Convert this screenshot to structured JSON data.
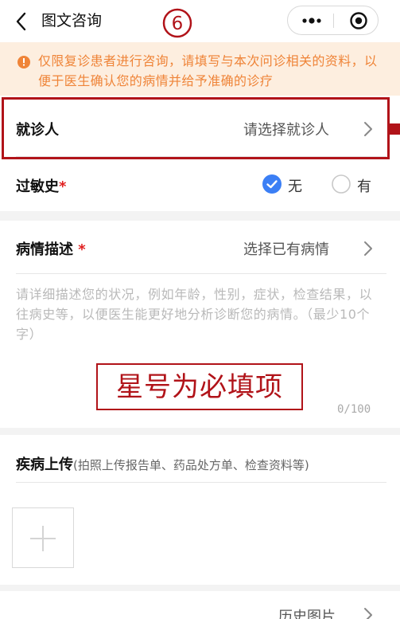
{
  "header": {
    "title": "图文咨询",
    "step_badge": "⑥"
  },
  "notice": {
    "text": "仅限复诊患者进行咨询，请填写与本次问诊相关的资料，以便于医生确认您的病情并给予准确的诊疗"
  },
  "patient": {
    "label": "就诊人",
    "placeholder": "请选择就诊人"
  },
  "allergy": {
    "label": "过敏史",
    "required_mark": "*",
    "options": [
      {
        "label": "无",
        "selected": true
      },
      {
        "label": "有",
        "selected": false
      }
    ]
  },
  "condition": {
    "label": "病情描述",
    "required_mark": "*",
    "select_existing": "选择已有病情",
    "placeholder": "请详细描述您的状况，例如年龄，性别，症状，检查结果，以往病史等，以便医生能更好地分析诊断您的病情。（最少10个字）",
    "counter": "0/100"
  },
  "annotation": {
    "stamp_text": "星号为必填项"
  },
  "upload": {
    "label": "疾病上传",
    "hint": "(拍照上传报告单、药品处方单、检查资料等)"
  },
  "history": {
    "label": "历史图片"
  },
  "colors": {
    "accent_blue": "#3b7ff5",
    "notice_orange": "#ef8438",
    "notice_bg": "#fdeedf",
    "annotation_red": "#b11319",
    "required_red": "#e02020"
  }
}
